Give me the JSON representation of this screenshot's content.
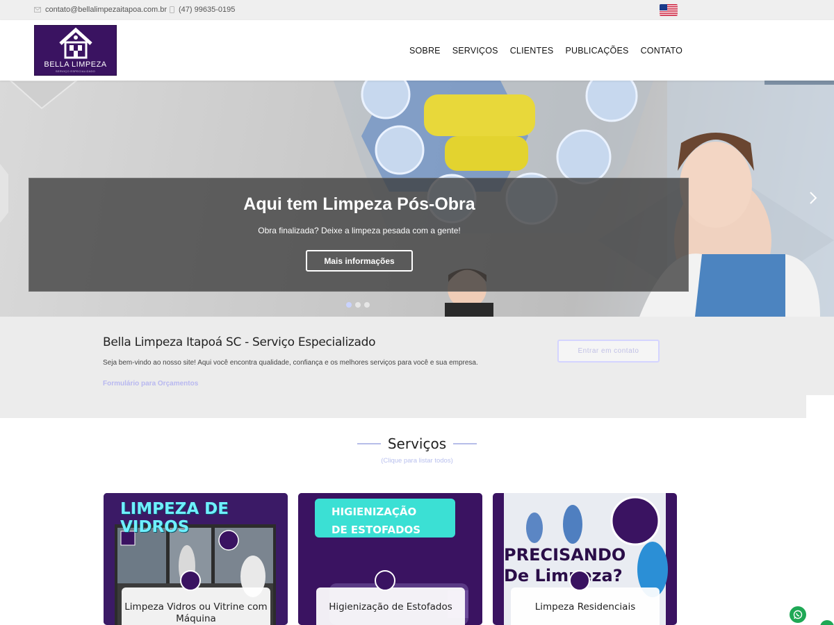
{
  "topbar": {
    "email": "contato@bellalimpezaitapoa.com.br",
    "phone": "(47) 99635-0195",
    "flag_icon": "us-flag-icon"
  },
  "header": {
    "logo_text": "BELLA LIMPEZA",
    "logo_sub": "SERVIÇO ESPECIALIZADO",
    "nav": [
      "SOBRE",
      "SERVIÇOS",
      "CLIENTES",
      "PUBLICAÇÕES",
      "CONTATO"
    ]
  },
  "hero": {
    "title": "Aqui tem Limpeza Pós-Obra",
    "subtitle": "Obra finalizada? Deixe a limpeza pesada com a gente!",
    "button": "Mais informações",
    "slides": 3,
    "active_slide": 1
  },
  "intro": {
    "title": "Bella Limpeza Itapoá SC - Serviço Especializado",
    "text": "Seja bem-vindo ao nosso site! Aqui você encontra qualidade, confiança e os melhores serviços para você e sua empresa.",
    "form_link": "Formulário para Orçamentos",
    "contact_button": "Entrar em contato"
  },
  "services": {
    "title": "Serviços",
    "subtitle": "(Clique para listar todos)",
    "cards": [
      {
        "image_title": "LIMPEZA DE VIDROS",
        "label": "Limpeza Vidros ou Vitrine com Máquina"
      },
      {
        "image_title": "HIGIENIZAÇÃO DE ESTOFADOS",
        "label": "Higienização de Estofados"
      },
      {
        "image_title": "PRECISANDO De Limpeza?",
        "label": "Limpeza Residenciais"
      }
    ]
  },
  "colors": {
    "brand_purple": "#3a1361",
    "accent_lavender": "#b8b8f0",
    "whatsapp_green": "#1fa855"
  }
}
